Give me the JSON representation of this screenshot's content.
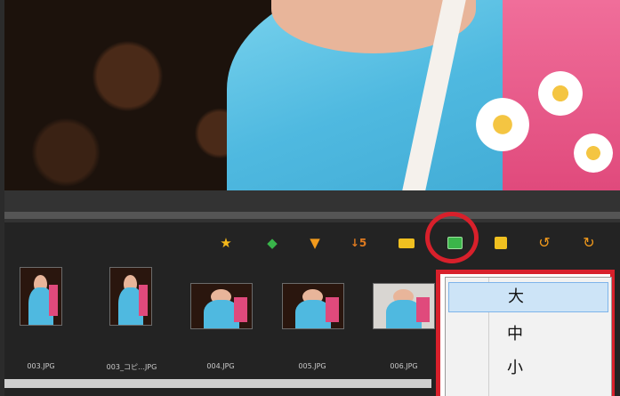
{
  "toolbar": {
    "icons": [
      "star-icon",
      "tag-icon",
      "filter-icon",
      "sort-icon",
      "label-icon",
      "thumbnail-size-icon",
      "slideshow-icon",
      "rotate-left-icon",
      "rotate-right-icon"
    ],
    "sort_glyph": "↓5"
  },
  "thumbnails": [
    {
      "filename": "003.JPG"
    },
    {
      "filename": "003_コピ…JPG"
    },
    {
      "filename": "004.JPG"
    },
    {
      "filename": "005.JPG"
    },
    {
      "filename": "006.JPG"
    }
  ],
  "thumbnail_size_menu": {
    "items": [
      {
        "label": "大",
        "selected": true
      },
      {
        "label": "中",
        "selected": false
      },
      {
        "label": "小",
        "selected": false
      }
    ]
  },
  "colors": {
    "highlight": "#d8202b",
    "selection": "#cde4f7",
    "panel": "#232323"
  }
}
